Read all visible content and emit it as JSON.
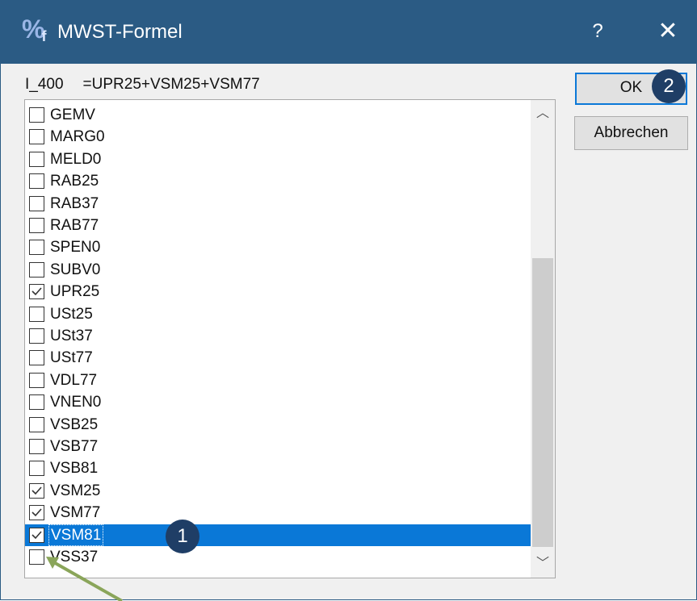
{
  "window": {
    "title": "MWST-Formel",
    "help_glyph": "?",
    "close_glyph": "✕",
    "icon_glyph": "%",
    "icon_sub": "f"
  },
  "formula": {
    "name": "I_400",
    "expression": "=UPR25+VSM25+VSM77"
  },
  "list": {
    "items": [
      {
        "label": "GEMV",
        "checked": false
      },
      {
        "label": "MARG0",
        "checked": false
      },
      {
        "label": "MELD0",
        "checked": false
      },
      {
        "label": "RAB25",
        "checked": false
      },
      {
        "label": "RAB37",
        "checked": false
      },
      {
        "label": "RAB77",
        "checked": false
      },
      {
        "label": "SPEN0",
        "checked": false
      },
      {
        "label": "SUBV0",
        "checked": false
      },
      {
        "label": "UPR25",
        "checked": true
      },
      {
        "label": "USt25",
        "checked": false
      },
      {
        "label": "USt37",
        "checked": false
      },
      {
        "label": "USt77",
        "checked": false
      },
      {
        "label": "VDL77",
        "checked": false
      },
      {
        "label": "VNEN0",
        "checked": false
      },
      {
        "label": "VSB25",
        "checked": false
      },
      {
        "label": "VSB77",
        "checked": false
      },
      {
        "label": "VSB81",
        "checked": false
      },
      {
        "label": "VSM25",
        "checked": true
      },
      {
        "label": "VSM77",
        "checked": true
      },
      {
        "label": "VSM81",
        "checked": true,
        "selected": true
      },
      {
        "label": "VSS37",
        "checked": false
      }
    ]
  },
  "buttons": {
    "ok": "OK",
    "cancel": "Abbrechen"
  },
  "annotations": {
    "badge1": "1",
    "badge2": "2"
  },
  "colors": {
    "titlebar": "#2b5b84",
    "selection": "#0a78d7",
    "badge": "#1f3e66",
    "arrow": "#8aa55a"
  }
}
